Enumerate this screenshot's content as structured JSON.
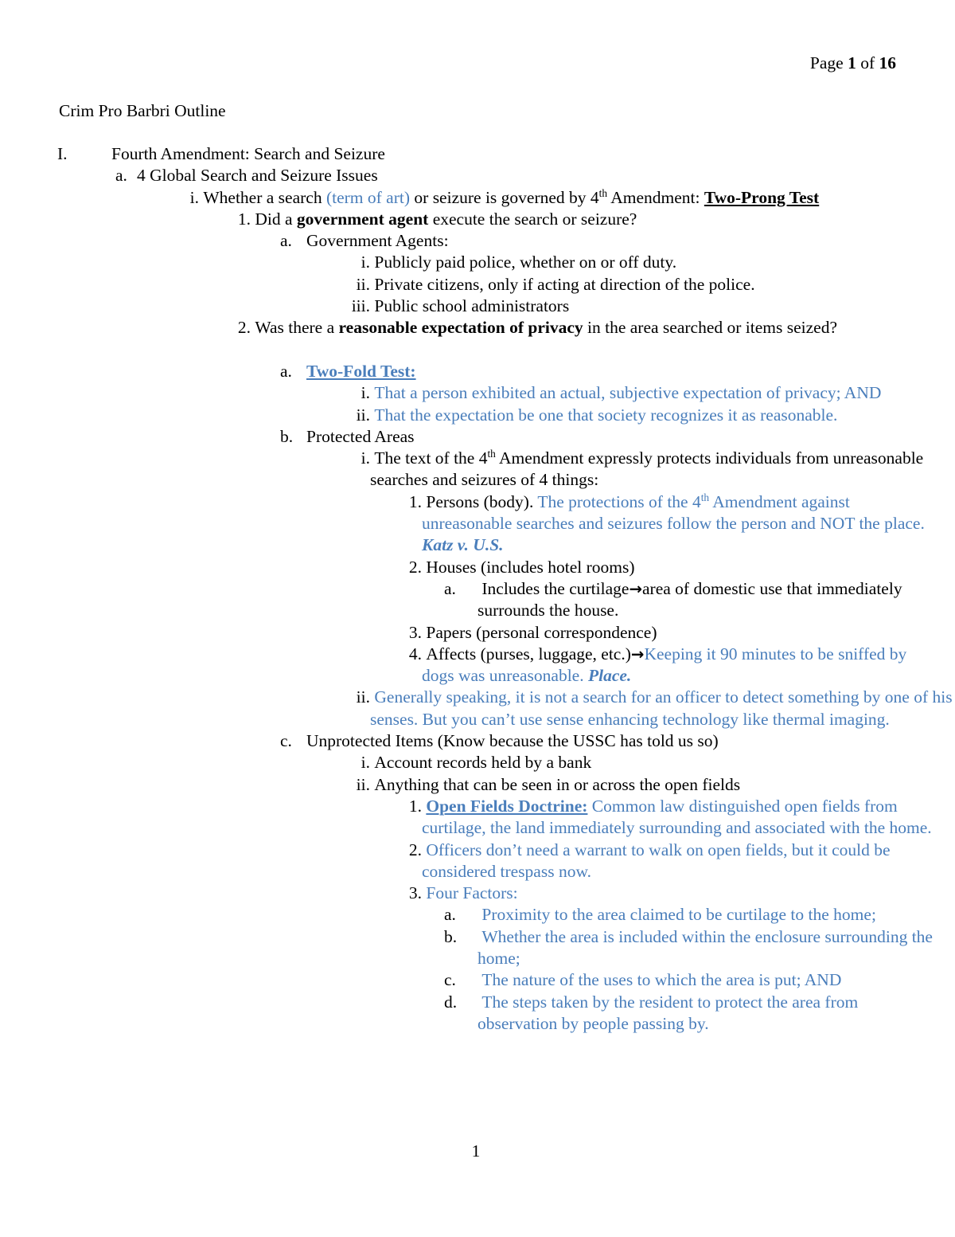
{
  "header": {
    "prefix": "Page",
    "page_number": "1",
    "middle": "of",
    "total_pages": "16"
  },
  "document": {
    "title": "Crim Pro Barbri Outline"
  },
  "colors": {
    "text": "#000000",
    "accent_blue": "#4a7ebb",
    "background": "#ffffff"
  },
  "footer": {
    "page_number": "1"
  },
  "outline": {
    "i_marker": "I.",
    "i_title": "Fourth Amendment: Search and Seizure",
    "a_marker": "a.",
    "a_title": "4 Global Search and Seizure Issues",
    "i1_marker": "i.",
    "i1_text_part1": "Whether a search ",
    "i1_text_blue": "(term of art)",
    "i1_text_part2": " or seizure is governed by 4",
    "i1_sup": "th",
    "i1_text_part3": " Amendment: ",
    "i1_text_bold": "Two-Prong Test",
    "n1_marker": "1.",
    "n1_text_part1": "Did a ",
    "n1_text_bold": "government agent",
    "n1_text_part2": " execute the search or seizure?",
    "ga_marker": "a.",
    "ga_title": "Government Agents:",
    "ga_i_marker": "i.",
    "ga_i_text": "Publicly paid police, whether on or off duty.",
    "ga_ii_marker": "ii.",
    "ga_ii_text": "Private citizens, only if acting at direction of the police.",
    "ga_iii_marker": "iii.",
    "ga_iii_text": "Public school administrators",
    "n2_marker": "2.",
    "n2_text_part1": "Was there a ",
    "n2_text_bold": "reasonable expectation of privacy",
    "n2_text_part2": " in the area searched or items seized?",
    "tf_marker": "a.",
    "tf_title": "Two-Fold Test:",
    "tf_i_marker": "i.",
    "tf_i_text": "That a person exhibited an actual, subjective expectation of privacy; AND",
    "tf_ii_marker": "ii.",
    "tf_ii_text": "That the expectation be one that society recognizes it as reasonable.",
    "pa_marker": "b.",
    "pa_title": "Protected Areas",
    "pa_i_marker": "i.",
    "pa_i_part1": "The text of the 4",
    "pa_i_sup": "th",
    "pa_i_part2": " Amendment expressly protects individuals from unreasonable searches and seizures of 4 things:",
    "p1_marker": "1.",
    "p1_black": "Persons (body). ",
    "p1_blue_part1": "The protections of the 4",
    "p1_sup": "th",
    "p1_blue_part2": " Amendment against unreasonable searches and seizures follow the person and NOT the place. ",
    "p1_case": "Katz v. U.S.",
    "p2_marker": "2.",
    "p2_text": "Houses (includes hotel rooms)",
    "p2a_marker": "a.",
    "p2a_part1": "Includes the curtilage",
    "p2a_arrow": "→",
    "p2a_part2": "area of domestic use that immediately surrounds the house.",
    "p3_marker": "3.",
    "p3_text": "Papers (personal correspondence)",
    "p4_marker": "4.",
    "p4_black": "Affects (purses, luggage, etc.)",
    "p4_arrow": "→",
    "p4_blue": "Keeping it 90 minutes to be sniffed by dogs was unreasonable. ",
    "p4_case": "Place.",
    "pa_ii_marker": "ii.",
    "pa_ii_text": "Generally speaking, it is not a search for an officer to detect something by one of his senses. But you can’t use sense enhancing technology like thermal imaging.",
    "up_marker": "c.",
    "up_title": "Unprotected Items (Know because the USSC has told us so)",
    "up_i_marker": "i.",
    "up_i_text": "Account records held by a bank",
    "up_ii_marker": "ii.",
    "up_ii_text": "Anything that can be seen in or across the open fields",
    "of1_marker": "1.",
    "of1_title": "Open Fields Doctrine:",
    "of1_text": " Common law distinguished open fields from curtilage, the land immediately surrounding and associated with the home.",
    "of2_marker": "2.",
    "of2_text": "Officers don’t need a warrant to walk on open fields, but it could be considered trespass now.",
    "of3_marker": "3.",
    "of3_text": "Four Factors:",
    "ff_a_marker": "a.",
    "ff_a_text": "Proximity to the area claimed to be curtilage to the home;",
    "ff_b_marker": "b.",
    "ff_b_text": "Whether the area is included within the enclosure surrounding the home;",
    "ff_c_marker": "c.",
    "ff_c_text": "The nature of the uses to which the area is put; AND",
    "ff_d_marker": "d.",
    "ff_d_text": "The steps taken by the resident to protect the area from observation by people passing by."
  }
}
